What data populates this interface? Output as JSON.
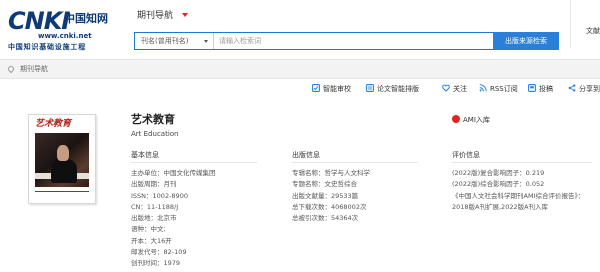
{
  "header": {
    "logo": {
      "brand": "CNKI",
      "chinese": "中国知网",
      "url": "www.cnki.net",
      "org": "中国知识基础设施工程"
    },
    "nav_title": "期刊导航",
    "search": {
      "field_select": "刊名(曾用刊名)",
      "placeholder": "请输入检索词",
      "button": "出版来源检索"
    },
    "right_link": "文献"
  },
  "breadcrumb": "期刊导航",
  "toolbar": [
    {
      "label": "智能审校",
      "icon": "doc-check-icon"
    },
    {
      "label": "论文智能排版",
      "icon": "layout-icon"
    },
    {
      "label": "关注",
      "icon": "heart-icon"
    },
    {
      "label": "RSS订阅",
      "icon": "rss-icon"
    },
    {
      "label": "投稿",
      "icon": "report-icon"
    },
    {
      "label": "分享到",
      "icon": "share-icon"
    }
  ],
  "journal": {
    "cover_title": "艺术教育",
    "title": "艺术教育",
    "english": "Art Education",
    "badge": "AMI入库"
  },
  "basic": {
    "heading": "基本信息",
    "rows": [
      "主办单位：中国文化传媒集团",
      "出版周期：月刊",
      "ISSN：1002-8900",
      "CN：11-1188/J",
      "出版地：北京市",
      "语种：中文;",
      "开本：大16开",
      "邮发代号：82-109",
      "创刊时间：1979"
    ]
  },
  "publish": {
    "heading": "出版信息",
    "rows": [
      "专辑名称：哲学与人文科学",
      "专题名称：文史哲综合",
      "出版文献量：29533篇",
      "总下载次数：4068002次",
      "总被引次数：54364次"
    ]
  },
  "evaluation": {
    "heading": "评价信息",
    "rows": [
      "(2022版)复合影响因子：0.219",
      "(2022版)综合影响因子：0.052",
      "《中国人文社会科学期刊AMI综合评价报告》：",
      "2018版A刊扩展,2022版A刊入库"
    ]
  },
  "colors": {
    "brand_blue": "#0e3a78",
    "accent_red": "#e1251b",
    "button_blue": "#2a80d8"
  }
}
